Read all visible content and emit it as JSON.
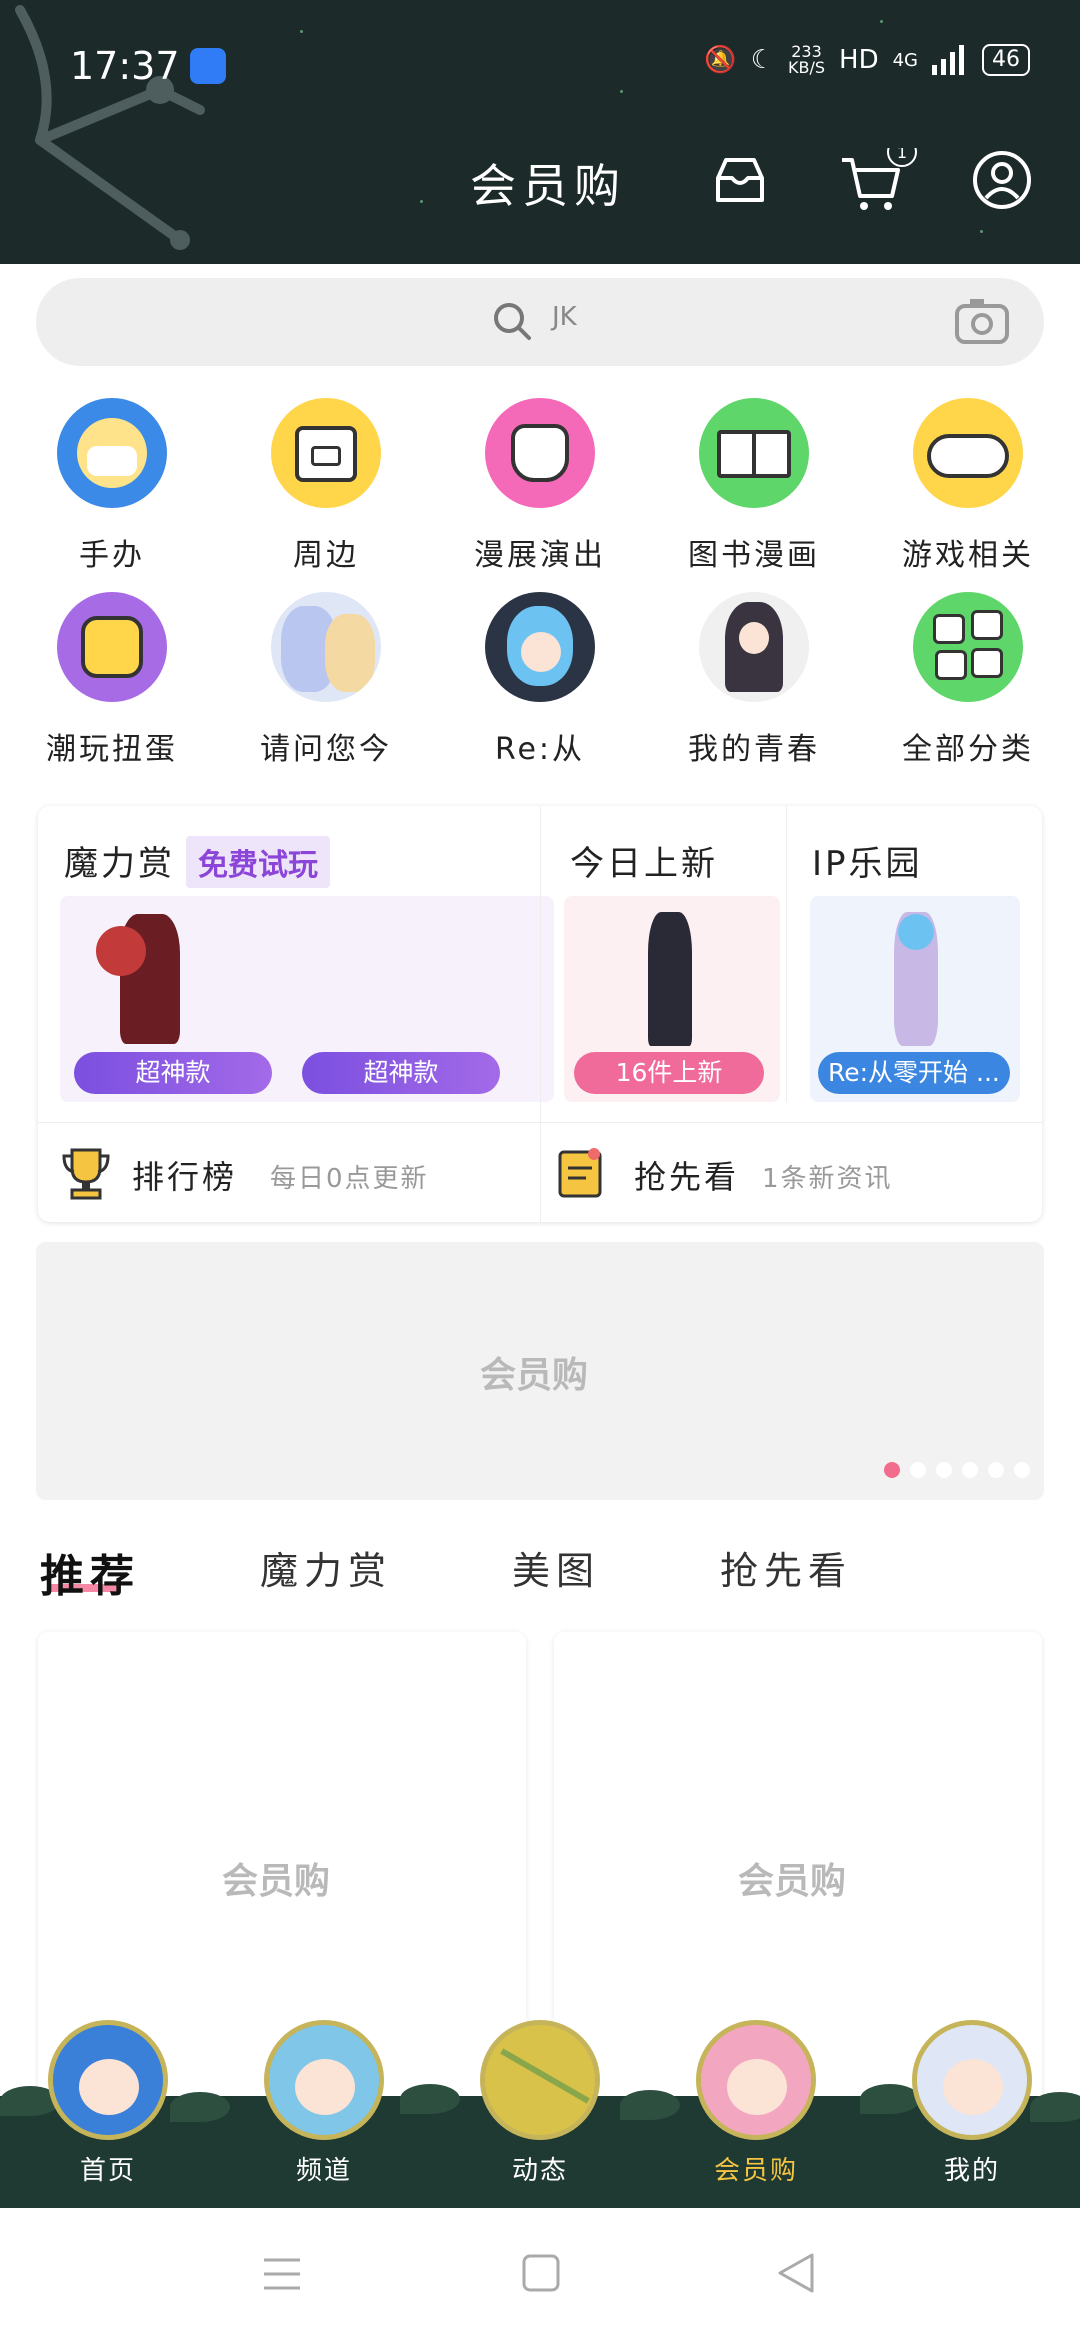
{
  "status_bar": {
    "time": "17:37",
    "net_speed_value": "233",
    "net_speed_unit": "KB/S",
    "hd": "HD",
    "network": "4G",
    "battery": "46"
  },
  "header": {
    "title": "会员购"
  },
  "search": {
    "placeholder": "JK"
  },
  "categories": [
    {
      "label": "手办"
    },
    {
      "label": "周边"
    },
    {
      "label": "漫展演出"
    },
    {
      "label": "图书漫画"
    },
    {
      "label": "游戏相关"
    },
    {
      "label": "潮玩扭蛋"
    },
    {
      "label": "请问您今"
    },
    {
      "label": "Re:从"
    },
    {
      "label": "我的青春"
    },
    {
      "label": "全部分类"
    }
  ],
  "feature_card": {
    "mofa_title": "魔力赏",
    "mofa_badge": "免费试玩",
    "mofa_pill_1": "超神款",
    "mofa_pill_2": "超神款",
    "today_title": "今日上新",
    "today_pill": "16件上新",
    "ip_title": "IP乐园",
    "ip_pill": "Re:从零开始 ...",
    "ranking_label": "排行榜",
    "ranking_sub": "每日0点更新",
    "preview_label": "抢先看",
    "preview_sub": "1条新资讯"
  },
  "banner": {
    "logo": "会员购"
  },
  "tabs": [
    {
      "label": "推荐"
    },
    {
      "label": "魔力赏"
    },
    {
      "label": "美图"
    },
    {
      "label": "抢先看"
    }
  ],
  "products": [
    {
      "logo": "会员购"
    },
    {
      "logo": "会员购"
    }
  ],
  "bottom_nav": [
    {
      "label": "首页"
    },
    {
      "label": "频道"
    },
    {
      "label": "动态"
    },
    {
      "label": "会员购"
    },
    {
      "label": "我的"
    }
  ],
  "colors": {
    "header_bg": "#1c2a2a",
    "accent_pink": "#f26c8e",
    "accent_purple": "#8b45d8",
    "nav_active": "#f5c542"
  }
}
